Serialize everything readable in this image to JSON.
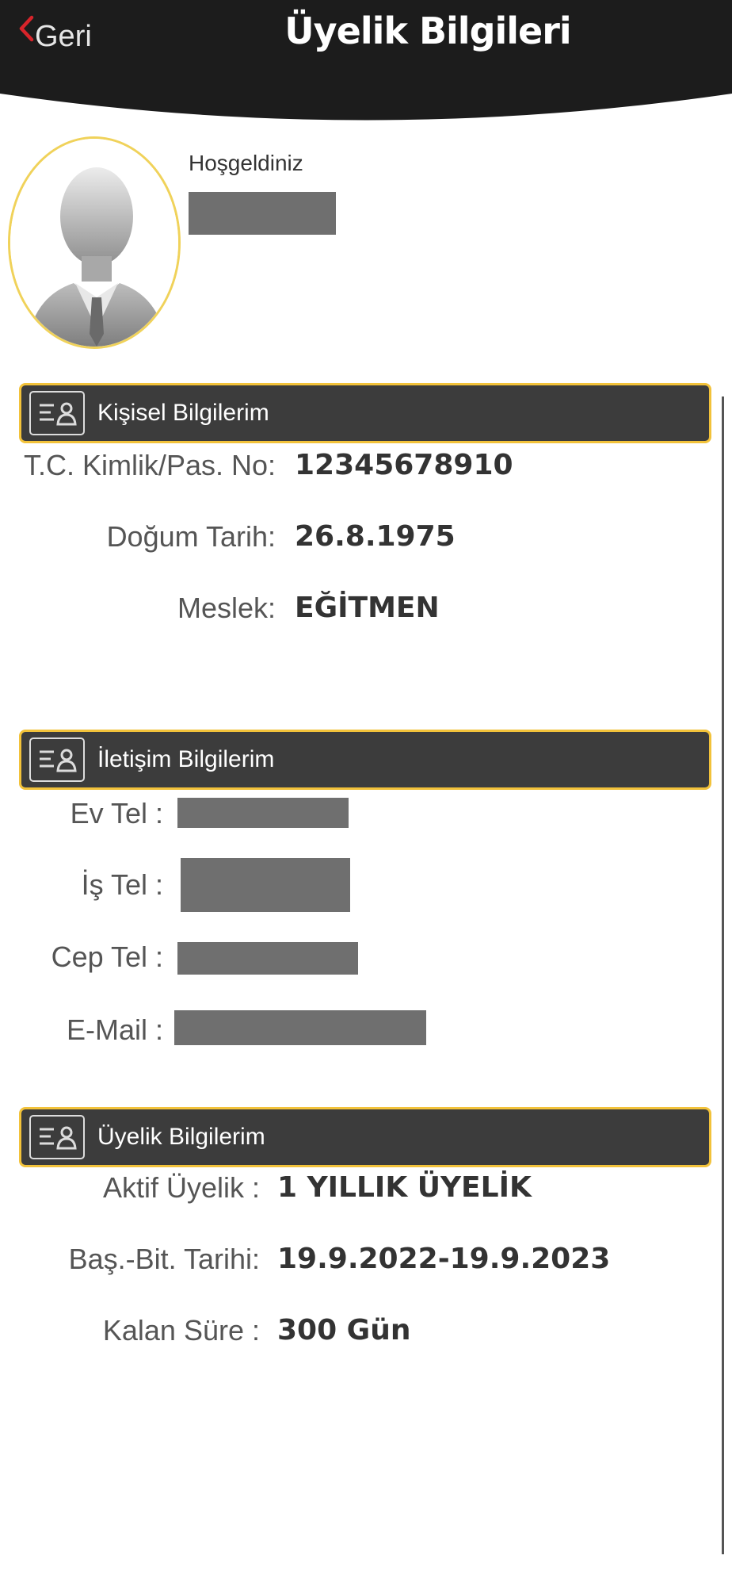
{
  "header": {
    "back_label": "Geri",
    "title": "Üyelik Bilgileri",
    "bg_color": "#1c1c1c",
    "back_icon_color": "#d8242a"
  },
  "profile": {
    "welcome": "Hoşgeldiniz"
  },
  "sections": {
    "personal": {
      "title": "Kişisel Bilgilerim",
      "fields": [
        {
          "label": "T.C. Kimlik/Pas. No:",
          "value": "12345678910"
        },
        {
          "label": "Doğum Tarih:",
          "value": "26.8.1975"
        },
        {
          "label": "Meslek:",
          "value": "EĞİTMEN"
        }
      ]
    },
    "contact": {
      "title": "İletişim Bilgilerim",
      "fields": [
        {
          "label": "Ev Tel :"
        },
        {
          "label": "İş Tel :"
        },
        {
          "label": "Cep Tel :"
        },
        {
          "label": "E-Mail :"
        }
      ]
    },
    "membership": {
      "title": "Üyelik Bilgilerim",
      "fields": [
        {
          "label": "Aktif Üyelik :",
          "value": "1 YILLIK ÜYELİK"
        },
        {
          "label": "Baş.-Bit. Tarihi:",
          "value": "19.9.2022-19.9.2023"
        },
        {
          "label": "Kalan Süre :",
          "value": "300 Gün"
        }
      ]
    }
  },
  "colors": {
    "accent": "#f2c23a",
    "section_bg": "#3c3c3c",
    "redaction": "#6f6f6f"
  }
}
